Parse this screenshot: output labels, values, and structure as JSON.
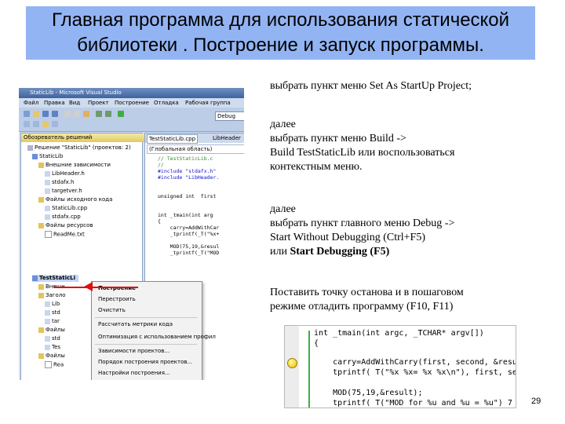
{
  "slide": {
    "title_line1": "Главная программа для использования статической",
    "title_line2": "библиотеки . Построение и запуск программы.",
    "page_number": "29"
  },
  "instructions": {
    "p1": "выбрать пункт меню Set As StartUp Project;",
    "p2_l1": "далее",
    "p2_l2": "выбрать пункт меню Build ->",
    "p2_l3": "Build  TestStaticLib или воспользоваться",
    "p2_l4": "контекстным меню.",
    "p3_l1": "далее",
    "p3_l2": "выбрать пункт главного меню Debug ->",
    "p3_l3": "Start Without Debugging (Ctrl+F5)",
    "p3_l4a": "или ",
    "p3_l4b": "Start Debugging (F5)",
    "p4_l1": "Поставить точку останова и в пошаговом",
    "p4_l2": "режиме отладить программу (F10, F11)"
  },
  "vs": {
    "window_title": "StaticLib - Microsoft Visual Studio",
    "menu": [
      "Файл",
      "Правка",
      "Вид",
      "Проект",
      "Построение",
      "Отладка",
      "Рабочая группа"
    ],
    "debug_combo": "Debug",
    "solution_explorer_title": "Обозреватель решений",
    "tree": [
      "Решение \"StaticLib\" (проектов: 2)",
      "StaticLib",
      "Внешние зависимости",
      "LibHeader.h",
      "stdafx.h",
      "targetver.h",
      "Файлы исходного кода",
      "StaticLib.cpp",
      "stdafx.cpp",
      "Файлы ресурсов",
      "ReadMe.txt",
      "TestStaticLi",
      "Внешн",
      "Заголо",
      "Lib",
      "std",
      "tar",
      "Файлы",
      "std",
      "Tes",
      "Файлы",
      "Rea"
    ],
    "editor_tabs": [
      "TestStaticLib.cpp",
      "LibHeader"
    ],
    "scope": "(Глобальная область)",
    "code": [
      "// TestStaticLib.c",
      "//",
      "#include \"stdafx.h\"",
      "#include \"LibHeader.",
      "",
      "unsigned int  first",
      "",
      "int _tmain(int arg",
      "{",
      "    carry=AddWithCar",
      "    _tprintf(_T(\"%x+",
      "",
      "    MOD(75,19,&resul",
      "    _tprintf(_T(\"MOD"
    ],
    "context_menu": [
      "Построение",
      "Перестроить",
      "Очистить",
      "Рассчитать метрики кода",
      "Оптимизация с использованием профил",
      "Зависимости проектов...",
      "Порядок построения проектов...",
      "Настройки построения..."
    ]
  },
  "code_shot": {
    "lines": [
      "int _tmain(int argc, _TCHAR* argv[])",
      "{",
      "    carry=AddWithCarry(first, second, &resu",
      "    tprintf( T(\"%x %x= %x %x\\n\"), first, se",
      "",
      "    MOD(75,19,&result);",
      "    tprintf( T(\"MOD for %u and %u = %u\") 7"
    ]
  }
}
